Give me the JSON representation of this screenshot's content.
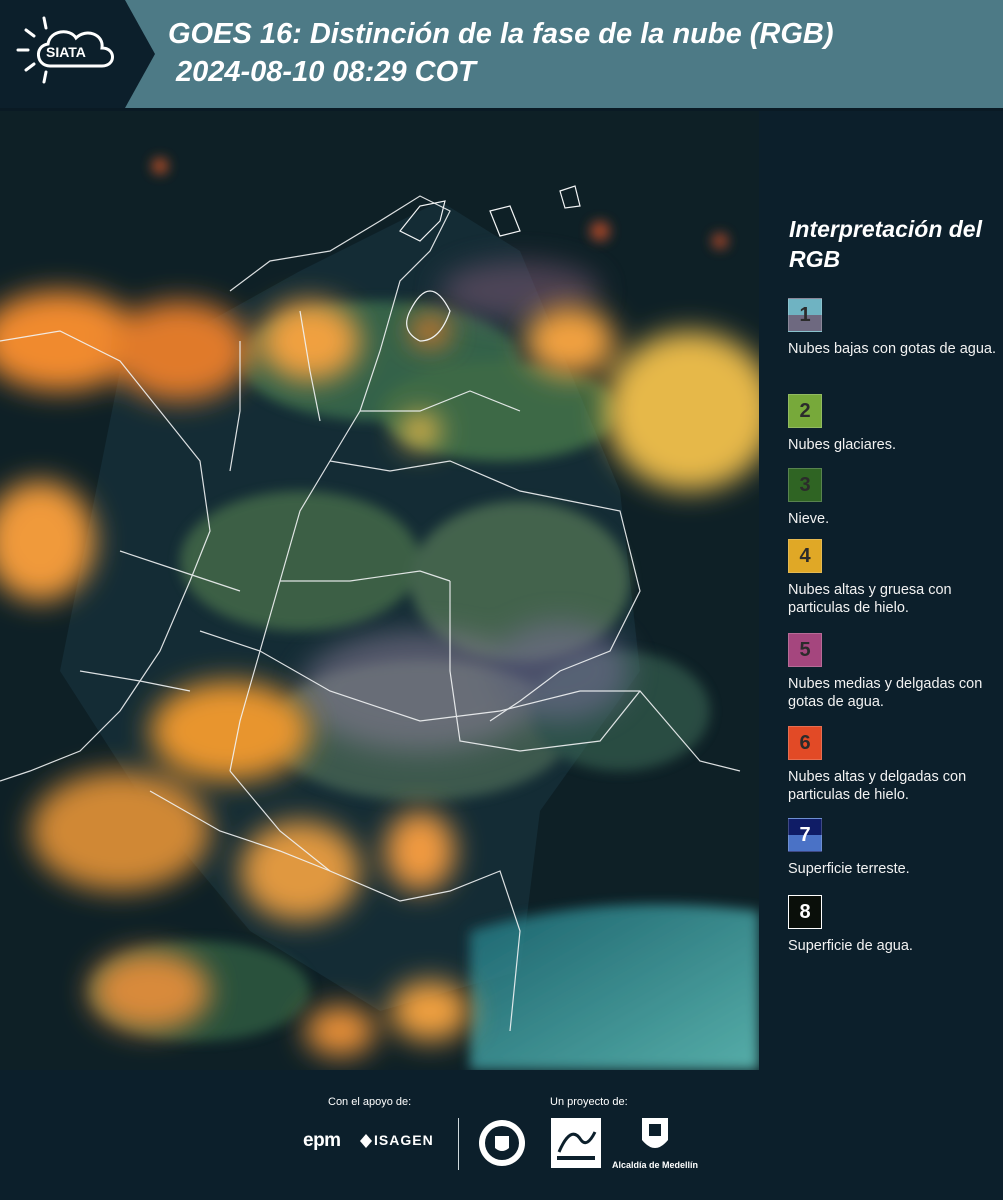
{
  "header": {
    "logo_text": "SIATA",
    "title": "GOES 16: Distinción de la fase de la nube (RGB)",
    "subtitle": "2024-08-10 08:29 COT"
  },
  "legend": {
    "title": "Interpretación del RGB",
    "items": [
      {
        "number": "1",
        "label": "Nubes bajas con gotas de agua.",
        "color_top": "#6fb3c2",
        "color_bottom": "#6e6980"
      },
      {
        "number": "2",
        "label": "Nubes glaciares.",
        "color_top": "#77a93a",
        "color_bottom": "#77a93a"
      },
      {
        "number": "3",
        "label": "Nieve.",
        "color_top": "#2f6423",
        "color_bottom": "#2f6423"
      },
      {
        "number": "4",
        "label": "Nubes altas y gruesa con particulas de hielo.",
        "color_top": "#e0a826",
        "color_bottom": "#e0a826"
      },
      {
        "number": "5",
        "label": "Nubes medias y delgadas con gotas de agua.",
        "color_top": "#a5467e",
        "color_bottom": "#a5467e"
      },
      {
        "number": "6",
        "label": "Nubes altas y delgadas con particulas de hielo.",
        "color_top": "#e24a26",
        "color_bottom": "#e24a26"
      },
      {
        "number": "7",
        "label": "Superficie terreste.",
        "color_top": "#0f1c66",
        "color_bottom": "#4a72c6"
      },
      {
        "number": "8",
        "label": "Superficie de agua.",
        "color_top": "#0a0f0a",
        "color_bottom": "#0a0f0a"
      }
    ]
  },
  "footer": {
    "support_label": "Con el apoyo de:",
    "project_label": "Un proyecto de:",
    "epm": "epm",
    "isagen": "ISAGEN",
    "alcaldia": "Alcaldía de Medellín"
  },
  "colors": {
    "header_bg": "#4d7a86",
    "panel_bg": "#0c1f2b",
    "cloud_orange": "#f0a03c",
    "ocean_cyan": "#4fb3b0"
  }
}
